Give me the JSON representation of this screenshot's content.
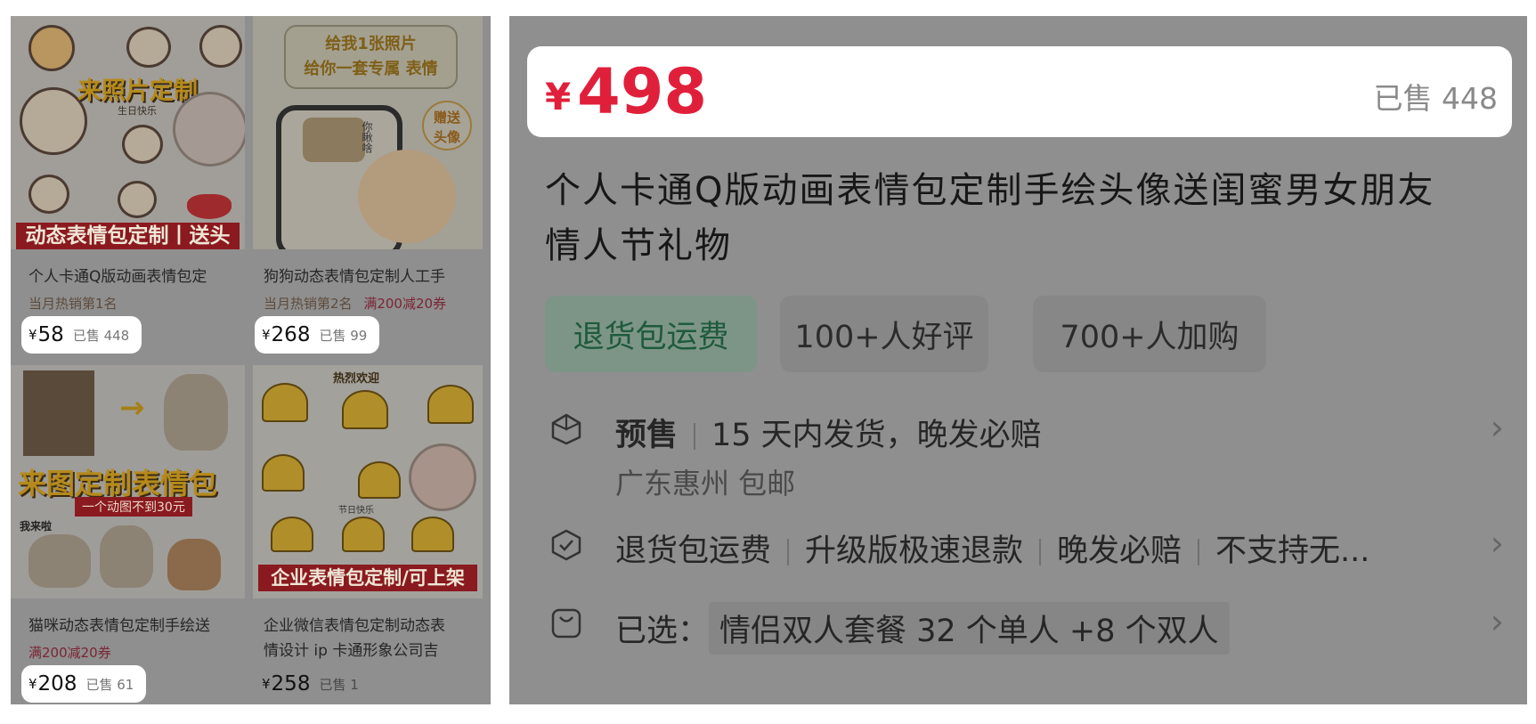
{
  "left_grid": {
    "products": [
      {
        "thumb_title": "来照片定制",
        "thumb_banner": "动态表情包定制丨送头像",
        "thumb_sub": "生日快乐",
        "title": "个人卡通Q版动画表情包定",
        "rank": "当月热销第1名",
        "promo": "",
        "currency": "¥",
        "price": "58",
        "sold": "已售 448"
      },
      {
        "thumb_title": "给我1张照片\n给你一套专属  表情",
        "thumb_badge": "赠送\n头像",
        "thumb_sub": "你瞅啥",
        "title": "狗狗动态表情包定制人工手",
        "rank": "当月热销第2名",
        "promo": "满200减20券",
        "currency": "¥",
        "price": "268",
        "sold": "已售 99"
      },
      {
        "thumb_title": "来图定制表情包",
        "thumb_subbanner": "一个动图不到30元",
        "thumb_sub": "我来啦",
        "title": "猫咪动态表情包定制手绘送",
        "rank": "",
        "promo": "满200减20券",
        "currency": "¥",
        "price": "208",
        "sold": "已售 61"
      },
      {
        "thumb_title": "热烈欢迎",
        "thumb_banner": "企业表情包定制/可上架",
        "thumb_sub": "节日快乐",
        "title": "企业微信表情包定制动态表",
        "title2": "情设计 ip 卡通形象公司吉",
        "rank": "",
        "promo": "",
        "currency": "¥",
        "price": "258",
        "sold": "已售 1"
      }
    ]
  },
  "detail": {
    "currency": "¥",
    "price": "498",
    "sold": "已售 448",
    "title": "个人卡通Q版动画表情包定制手绘头像送闺蜜男女朋友情人节礼物",
    "tags": [
      "退货包运费",
      "100+人好评",
      "700+人加购"
    ],
    "shipping": {
      "label": "预售",
      "text": "15 天内发货，晚发必赔",
      "origin": "广东惠州 包邮"
    },
    "guarantees": [
      "退货包运费",
      "升级版极速退款",
      "晚发必赔",
      "不支持无..."
    ],
    "selected": {
      "label": "已选：",
      "value": "情侣双人套餐 32 个单人 +8 个双人"
    },
    "colors": {
      "price_red": "#e0203a",
      "tag_green": "#1f5a3c"
    }
  }
}
